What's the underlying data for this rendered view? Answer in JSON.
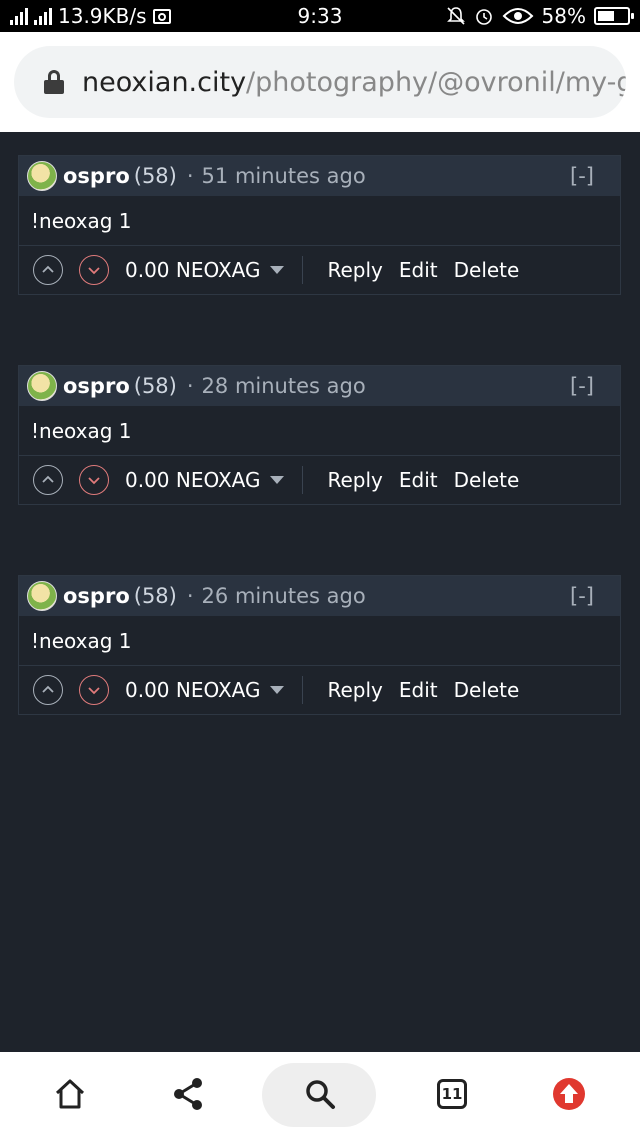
{
  "status_bar": {
    "network_speed": "13.9KB/s",
    "time": "9:33",
    "battery": "58%",
    "battery_level": 0.58
  },
  "address_bar": {
    "domain": "neoxian.city",
    "path": "/photography/@ovronil/my-gr"
  },
  "comments": [
    {
      "author": "ospro",
      "reputation": "(58)",
      "separator": "·",
      "time_ago": "51 minutes ago",
      "collapse": "[-]",
      "body": "!neoxag 1",
      "payout": "0.00 NEOXAG",
      "actions": {
        "reply": "Reply",
        "edit": "Edit",
        "delete": "Delete"
      }
    },
    {
      "author": "ospro",
      "reputation": "(58)",
      "separator": "·",
      "time_ago": "28 minutes ago",
      "collapse": "[-]",
      "body": "!neoxag 1",
      "payout": "0.00 NEOXAG",
      "actions": {
        "reply": "Reply",
        "edit": "Edit",
        "delete": "Delete"
      }
    },
    {
      "author": "ospro",
      "reputation": "(58)",
      "separator": "·",
      "time_ago": "26 minutes ago",
      "collapse": "[-]",
      "body": "!neoxag 1",
      "payout": "0.00 NEOXAG",
      "actions": {
        "reply": "Reply",
        "edit": "Edit",
        "delete": "Delete"
      }
    }
  ],
  "bottom_nav": {
    "tab_count": "11",
    "items": [
      "home-icon",
      "share-icon",
      "search-icon",
      "tabs-icon",
      "upvote-icon"
    ],
    "upvote_color": "#e0382f"
  },
  "colors": {
    "background": "#1e232b",
    "comment_header": "#2a3340",
    "downvote": "#e07b7b"
  }
}
